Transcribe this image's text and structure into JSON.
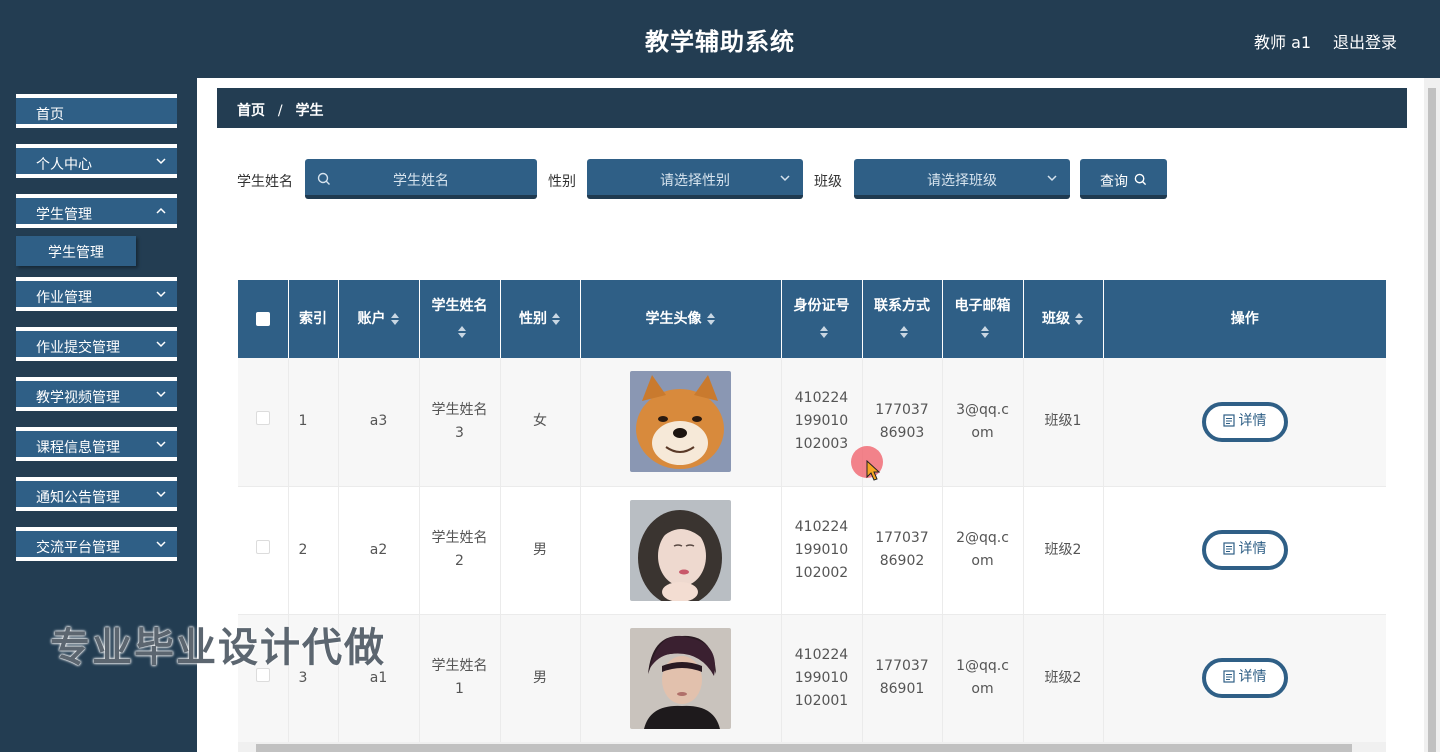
{
  "header": {
    "title": "教学辅助系统",
    "user": "教师 a1",
    "logout": "退出登录"
  },
  "sidebar": {
    "items": [
      {
        "label": "首页",
        "has_chevron": false
      },
      {
        "label": "个人中心",
        "has_chevron": true
      },
      {
        "label": "学生管理",
        "has_chevron": true,
        "expanded": true
      },
      {
        "label": "作业管理",
        "has_chevron": true
      },
      {
        "label": "作业提交管理",
        "has_chevron": true
      },
      {
        "label": "教学视频管理",
        "has_chevron": true
      },
      {
        "label": "课程信息管理",
        "has_chevron": true
      },
      {
        "label": "通知公告管理",
        "has_chevron": true
      },
      {
        "label": "交流平台管理",
        "has_chevron": true
      }
    ],
    "sub_item": {
      "label": "学生管理"
    }
  },
  "breadcrumb": {
    "home": "首页",
    "separator": "/",
    "current": "学生"
  },
  "search": {
    "name_label": "学生姓名",
    "name_placeholder": "学生姓名",
    "gender_label": "性别",
    "gender_placeholder": "请选择性别",
    "class_label": "班级",
    "class_placeholder": "请选择班级",
    "query_button": "查询"
  },
  "table": {
    "headers": {
      "index": "索引",
      "account": "账户",
      "name": "学生姓名",
      "gender": "性别",
      "avatar": "学生头像",
      "id_card": "身份证号",
      "phone": "联系方式",
      "email": "电子邮箱",
      "class": "班级",
      "actions": "操作"
    },
    "rows": [
      {
        "index": "1",
        "account": "a3",
        "name": "学生姓名3",
        "gender": "女",
        "avatar": "shiba-dog-photo",
        "id_card": "410224199010102003",
        "phone": "17703786903",
        "email": "3@qq.com",
        "class": "班级1",
        "action": "详情"
      },
      {
        "index": "2",
        "account": "a2",
        "name": "学生姓名2",
        "gender": "男",
        "avatar": "girl-portrait-photo",
        "id_card": "410224199010102002",
        "phone": "17703786902",
        "email": "2@qq.com",
        "class": "班级2",
        "action": "详情"
      },
      {
        "index": "3",
        "account": "a1",
        "name": "学生姓名1",
        "gender": "男",
        "avatar": "boy-portrait-photo",
        "id_card": "410224199010102001",
        "phone": "17703786901",
        "email": "1@qq.com",
        "class": "班级2",
        "action": "详情"
      }
    ]
  },
  "watermark": "专业毕业设计代做",
  "colors": {
    "header_bg": "#233d52",
    "accent": "#2f5f86",
    "row_alt": "#f7f7f7"
  }
}
